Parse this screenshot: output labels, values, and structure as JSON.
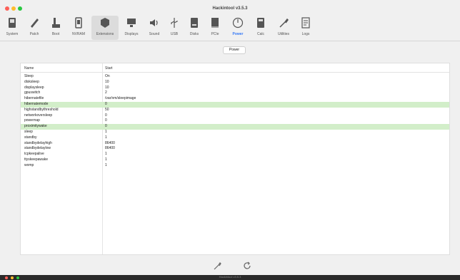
{
  "window": {
    "title": "Hackintool v3.5.3"
  },
  "toolbar": {
    "items": [
      {
        "label": "System",
        "icon": "system-icon"
      },
      {
        "label": "Patch",
        "icon": "patch-icon"
      },
      {
        "label": "Boot",
        "icon": "boot-icon"
      },
      {
        "label": "NVRAM",
        "icon": "nvram-icon"
      },
      {
        "label": "Extensions",
        "icon": "extensions-icon"
      },
      {
        "label": "Displays",
        "icon": "displays-icon"
      },
      {
        "label": "Sound",
        "icon": "sound-icon"
      },
      {
        "label": "USB",
        "icon": "usb-icon"
      },
      {
        "label": "Disks",
        "icon": "disks-icon"
      },
      {
        "label": "PCIe",
        "icon": "pcie-icon"
      },
      {
        "label": "Power",
        "icon": "power-icon"
      },
      {
        "label": "Calc",
        "icon": "calc-icon"
      },
      {
        "label": "Utilities",
        "icon": "utilities-icon"
      },
      {
        "label": "Logs",
        "icon": "logs-icon"
      }
    ]
  },
  "tab": {
    "label": "Power"
  },
  "table": {
    "headers": [
      "Name",
      "Start"
    ],
    "rows": [
      {
        "name": "Sleep",
        "value": "On"
      },
      {
        "name": "disksleep",
        "value": "10"
      },
      {
        "name": "displaysleep",
        "value": "10"
      },
      {
        "name": "gpuswitch",
        "value": "2"
      },
      {
        "name": "hibernatefile",
        "value": "/var/vm/sleepimage"
      },
      {
        "name": "hibernatemode",
        "value": "0"
      },
      {
        "name": "highstandbythreshold",
        "value": "50"
      },
      {
        "name": "networkoversleep",
        "value": "0"
      },
      {
        "name": "powernap",
        "value": "0"
      },
      {
        "name": "proximitywake",
        "value": "0"
      },
      {
        "name": "sleep",
        "value": "1"
      },
      {
        "name": "standby",
        "value": "1"
      },
      {
        "name": "standbydelayhigh",
        "value": "86400"
      },
      {
        "name": "standbydelaylow",
        "value": "86400"
      },
      {
        "name": "tcpkeepalive",
        "value": "1"
      },
      {
        "name": "ttyskeepawake",
        "value": "1"
      },
      {
        "name": "womp",
        "value": "1"
      }
    ]
  },
  "footer": {
    "icons": [
      "wrench-icon",
      "refresh-icon"
    ]
  },
  "dock": {
    "title": "Hackintool v3.5.3"
  }
}
